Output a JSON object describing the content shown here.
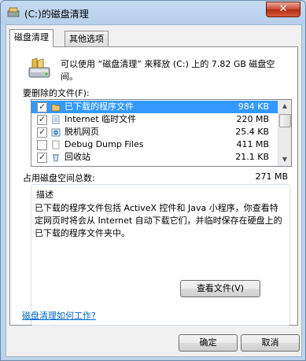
{
  "window": {
    "title": "(C:)的磁盘清理",
    "close_label": "✕"
  },
  "tabs": [
    {
      "label": "磁盘清理"
    },
    {
      "label": "其他选项"
    }
  ],
  "intro": "可以使用 “磁盘清理” 来释放  (C:) 上的 7.82 GB 磁盘空间。",
  "files_label": "要删除的文件(F):",
  "files": [
    {
      "name": "已下载的程序文件",
      "size": "984 KB",
      "checked": true,
      "selected": true,
      "icon": "folder-icon"
    },
    {
      "name": "Internet 临时文件",
      "size": "220 MB",
      "checked": true,
      "selected": false,
      "icon": "document-icon"
    },
    {
      "name": "脱机网页",
      "size": "25.4 KB",
      "checked": true,
      "selected": false,
      "icon": "offline-page-icon"
    },
    {
      "name": "Debug Dump Files",
      "size": "411 MB",
      "checked": false,
      "selected": false,
      "icon": "blank-file-icon"
    },
    {
      "name": "回收站",
      "size": "21.1 KB",
      "checked": true,
      "selected": false,
      "icon": "recycle-bin-icon"
    }
  ],
  "total_label": "占用磁盘空间总数:",
  "total_value": "271 MB",
  "description": {
    "title": "描述",
    "text": "已下载的程序文件包括 ActiveX 控件和 Java 小程序，你查看特定网页时将会从 Internet 自动下载它们，并临时保存在硬盘上的已下载的程序文件夹中。",
    "view_files_label": "查看文件(V)"
  },
  "help_link": "磁盘清理如何工作?",
  "buttons": {
    "ok": "确定",
    "cancel": "取消"
  },
  "colors": {
    "selection": "#3399ff",
    "link": "#0066cc",
    "close": "#c8452f"
  }
}
